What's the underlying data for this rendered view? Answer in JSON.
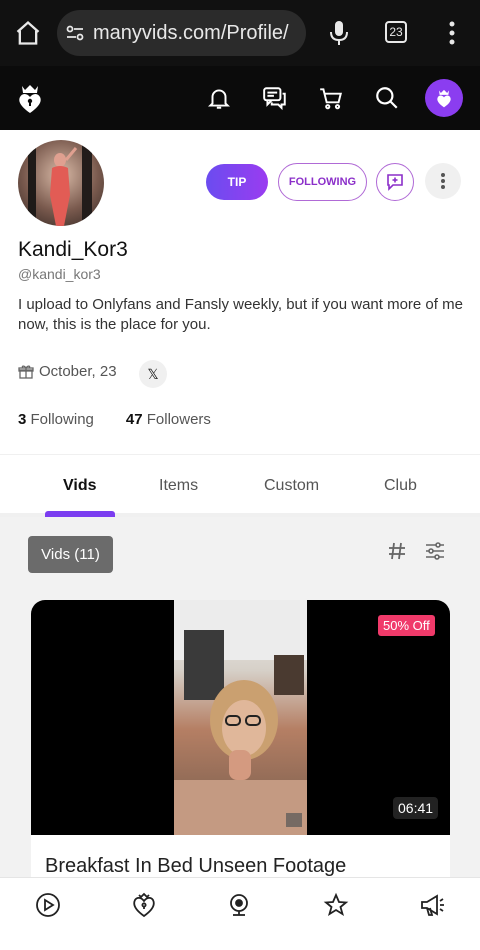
{
  "browser": {
    "url": "manyvids.com/Profile/",
    "tab_count": "23"
  },
  "colors": {
    "accent": "#7b3df0",
    "discount": "#f03a6a"
  },
  "profile": {
    "actions": {
      "tip_label": "TIP",
      "following_label": "FOLLOWING"
    },
    "username": "Kandi_Kor3",
    "handle": "@kandi_kor3",
    "bio": "I upload to Onlyfans and Fansly weekly, but if you want more of me now, this is the place for you.",
    "joined": "October, 23",
    "social": "𝕏",
    "stats": {
      "following_count": "3",
      "following_label": "Following",
      "followers_count": "47",
      "followers_label": "Followers"
    }
  },
  "tabs": [
    {
      "label": "Vids",
      "active": true
    },
    {
      "label": "Items",
      "active": false
    },
    {
      "label": "Custom",
      "active": false
    },
    {
      "label": "Club",
      "active": false
    }
  ],
  "content": {
    "vids_chip": "Vids (11)",
    "cards": [
      {
        "discount": "50% Off",
        "duration": "06:41",
        "title": "Breakfast In Bed Unseen Footage"
      }
    ]
  },
  "icons": {
    "header": [
      "logo-icon",
      "bell-icon",
      "chat-icon",
      "cart-icon",
      "search-icon",
      "avatar-icon"
    ],
    "bottom_nav": [
      "play-icon",
      "heart-lock-icon",
      "webcam-icon",
      "star-icon",
      "megaphone-icon"
    ]
  }
}
